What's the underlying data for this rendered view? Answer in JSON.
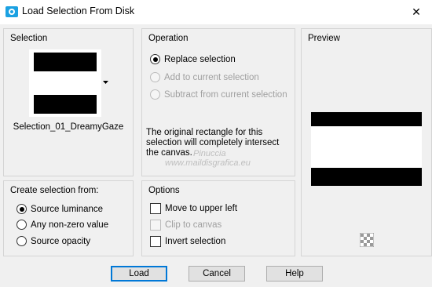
{
  "window": {
    "title": "Load Selection From Disk",
    "close_glyph": "✕"
  },
  "selection": {
    "heading": "Selection",
    "file_name": "Selection_01_DreamyGaze"
  },
  "operation": {
    "heading": "Operation",
    "options": [
      {
        "label": "Replace selection",
        "checked": true,
        "enabled": true
      },
      {
        "label": "Add to current selection",
        "checked": false,
        "enabled": false
      },
      {
        "label": "Subtract from current selection",
        "checked": false,
        "enabled": false
      }
    ],
    "message_line1": "The original rectangle for this",
    "message_line2": "selection will completely intersect",
    "message_line3": "the canvas."
  },
  "preview": {
    "heading": "Preview"
  },
  "create_from": {
    "heading": "Create selection from:",
    "options": [
      {
        "label": "Source luminance",
        "checked": true
      },
      {
        "label": "Any non-zero value",
        "checked": false
      },
      {
        "label": "Source opacity",
        "checked": false
      }
    ]
  },
  "options": {
    "heading": "Options",
    "items": [
      {
        "label": "Move to upper left",
        "checked": false,
        "enabled": true
      },
      {
        "label": "Clip to canvas",
        "checked": false,
        "enabled": false
      },
      {
        "label": "Invert selection",
        "checked": false,
        "enabled": true
      }
    ]
  },
  "buttons": {
    "load": "Load",
    "cancel": "Cancel",
    "help": "Help"
  },
  "watermark": {
    "line1": "Pinuccia",
    "line2": "www.maildisgrafica.eu"
  },
  "icons": {
    "app": "psp-app-icon",
    "close": "close-icon",
    "dropdown": "chevron-down-icon",
    "checker": "transparency-checker-icon"
  },
  "colors": {
    "window_bg": "#f0f0f0",
    "titlebar_bg": "#ffffff",
    "panel_border": "#d4d4d4",
    "default_button_border": "#0078d7",
    "disabled_text": "#a0a0a0",
    "app_icon": "#1ba1e2"
  }
}
